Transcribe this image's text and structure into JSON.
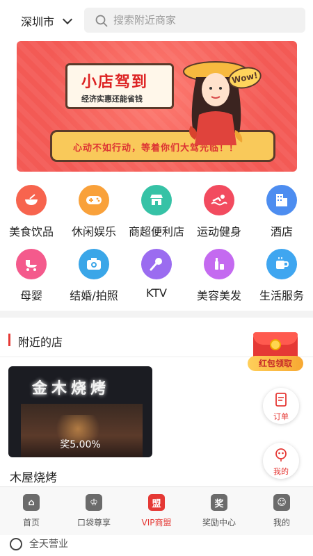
{
  "header": {
    "city": "深圳市",
    "search_placeholder": "搜索附近商家"
  },
  "banner": {
    "title": "小店驾到",
    "subtitle": "经济实惠还能省钱",
    "wow": "Wow!",
    "slogan": "心动不如行动，等着你们大驾光临！！"
  },
  "categories": [
    {
      "label": "美食饮品",
      "icon": "bowl-icon",
      "color": "#f7644e"
    },
    {
      "label": "休闲娱乐",
      "icon": "gamepad-icon",
      "color": "#f9a13a"
    },
    {
      "label": "商超便利店",
      "icon": "store-icon",
      "color": "#36c2a6"
    },
    {
      "label": "运动健身",
      "icon": "swim-icon",
      "color": "#f24b5f"
    },
    {
      "label": "酒店",
      "icon": "hotel-icon",
      "color": "#4d8df0"
    },
    {
      "label": "母婴",
      "icon": "stroller-icon",
      "color": "#f45a8c"
    },
    {
      "label": "结婚/拍照",
      "icon": "camera-icon",
      "color": "#3aa6e8"
    },
    {
      "label": "KTV",
      "icon": "microphone-icon",
      "color": "#9b6cf0"
    },
    {
      "label": "美容美发",
      "icon": "cosmetics-icon",
      "color": "#c46af0"
    },
    {
      "label": "生活服务",
      "icon": "cup-icon",
      "color": "#3fa6f0"
    }
  ],
  "nearby": {
    "title": "附近的店",
    "shops": [
      {
        "name": "木屋烧烤",
        "promo": "奖5.00%",
        "sign": "金木烧烤"
      }
    ]
  },
  "floating": {
    "redpacket": "红包领取",
    "orders": "订单",
    "mine": "我的"
  },
  "tabs": [
    {
      "label": "首页",
      "icon": "home-icon",
      "glyph": "⌂"
    },
    {
      "label": "口袋尊享",
      "icon": "crown-icon",
      "glyph": "♔"
    },
    {
      "label": "VIP商盟",
      "icon": "vip-alliance-icon",
      "glyph": "盟",
      "active": true
    },
    {
      "label": "奖励中心",
      "icon": "reward-icon",
      "glyph": "奖"
    },
    {
      "label": "我的",
      "icon": "user-icon",
      "glyph": "☺"
    }
  ],
  "bottom_peek": {
    "text": "全天营业"
  }
}
